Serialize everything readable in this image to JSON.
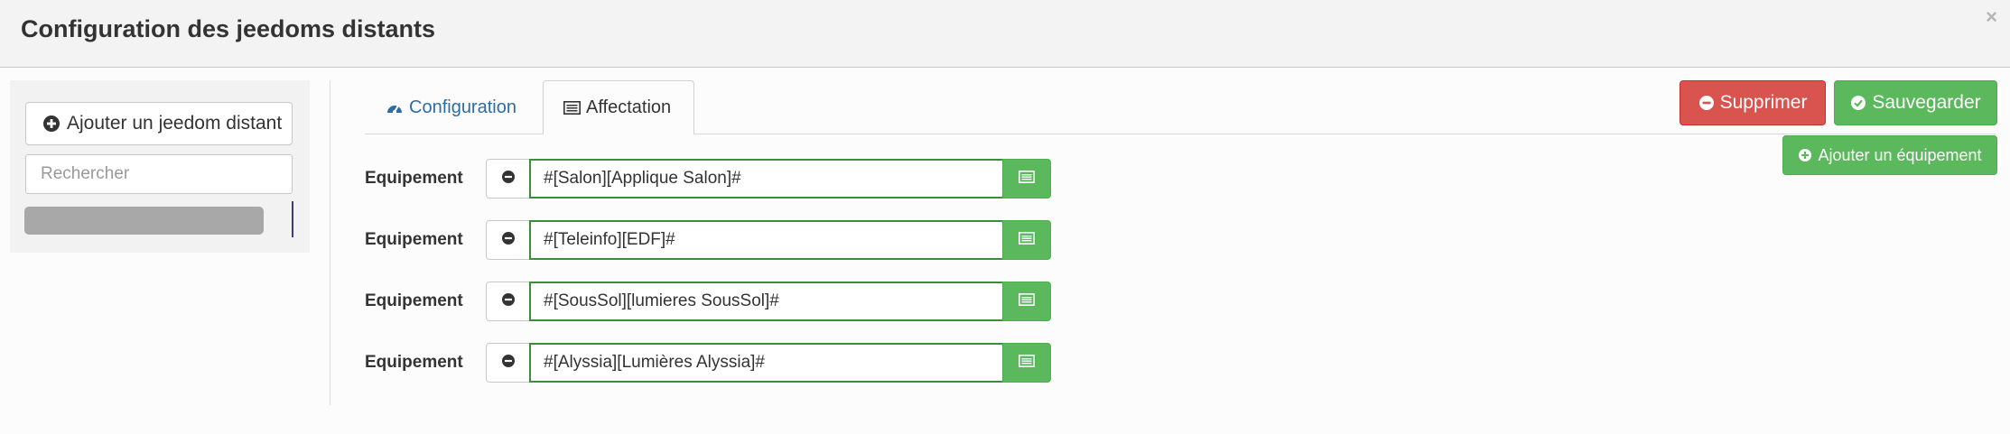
{
  "modal": {
    "title": "Configuration des jeedoms distants",
    "close_label": "×"
  },
  "sidebar": {
    "add_button_label": "Ajouter un jeedom distant",
    "search_placeholder": "Rechercher"
  },
  "tabs": [
    {
      "label": "Configuration",
      "icon": "dashboard-icon",
      "active": false
    },
    {
      "label": "Affectation",
      "icon": "list-icon",
      "active": true
    }
  ],
  "actions": {
    "delete_label": "Supprimer",
    "save_label": "Sauvegarder",
    "add_equipment_label": "Ajouter un équipement"
  },
  "equipments": [
    {
      "label": "Equipement",
      "value": "#[Salon][Applique Salon]#"
    },
    {
      "label": "Equipement",
      "value": "#[Teleinfo][EDF]#"
    },
    {
      "label": "Equipement",
      "value": "#[SousSol][lumieres SousSol]#"
    },
    {
      "label": "Equipement",
      "value": "#[Alyssia][Lumières Alyssia]#"
    }
  ],
  "colors": {
    "primary_green": "#5cb85c",
    "danger_red": "#d9534f",
    "link_blue": "#2d6da6"
  }
}
